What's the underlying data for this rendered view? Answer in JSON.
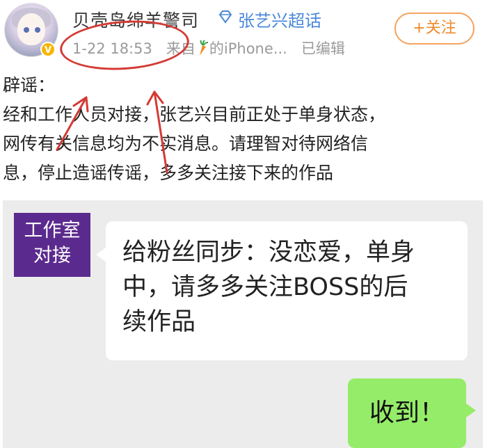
{
  "header": {
    "username": "贝壳岛绵羊警司",
    "super_topic": "张艺兴超话",
    "verified_badge": "V",
    "timestamp": "1-22 18:53",
    "source_prefix": "来自",
    "source_suffix": "的iPhone...",
    "edited": "已编辑",
    "follow_label": "+关注"
  },
  "post": {
    "lines": [
      "辟谣：",
      "经和工作人员对接，张艺兴目前正处于单身状态，",
      "网传有关信息均为不实消息。请理智对待网络信",
      "息，停止造谣传谣，多多关注接下来的作品"
    ]
  },
  "chat": {
    "studio_name_line1": "工作室",
    "studio_name_line2": "对接",
    "message_left_lines": [
      "给粉丝同步：没恋爱，单身",
      "中，请多多关注BOSS的后",
      "续作品"
    ],
    "message_right": "收到！"
  },
  "colors": {
    "accent_orange": "#ee8a2a",
    "link_blue": "#4a88d8",
    "annotation_red": "#d43a35",
    "studio_purple": "#5b2a8e",
    "reply_green": "#95ec69"
  },
  "icons": {
    "avatar": "anime-character-avatar",
    "badge": "verified-v-badge",
    "topic": "diamond-icon",
    "source": "carrot-icon"
  }
}
